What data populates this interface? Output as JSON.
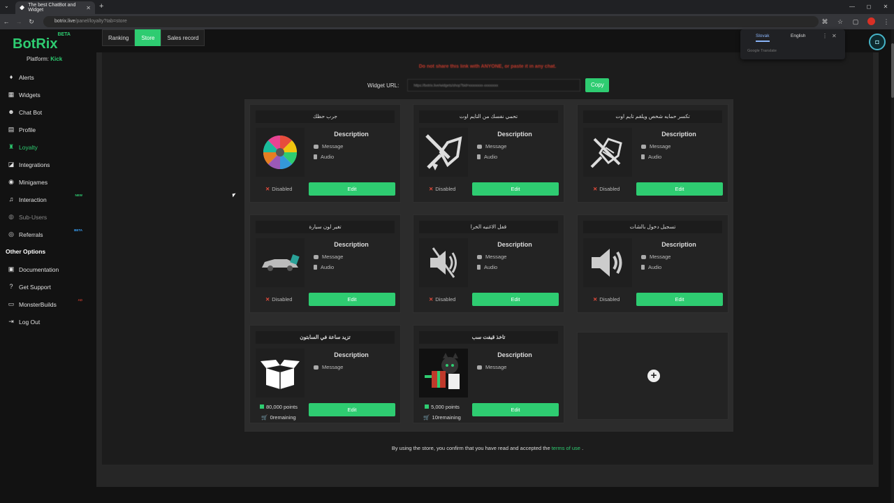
{
  "browser": {
    "tab_title": "The best ChatBot and Widget",
    "url_host": "botrix.live",
    "url_path": "/panel/loyalty?tab=store"
  },
  "translate_popup": {
    "option1": "Slovak",
    "option2": "English",
    "footer": "Google Translate"
  },
  "sidebar": {
    "logo": "BotRix",
    "logo_badge": "BETA",
    "platform_label": "Platform:",
    "platform_value": "Kick",
    "items": [
      {
        "label": "Alerts",
        "icon": "bell-icon"
      },
      {
        "label": "Widgets",
        "icon": "grid-icon"
      },
      {
        "label": "Chat Bot",
        "icon": "bot-icon"
      },
      {
        "label": "Profile",
        "icon": "profile-icon"
      },
      {
        "label": "Loyalty",
        "icon": "trophy-icon"
      },
      {
        "label": "Integrations",
        "icon": "integrations-icon"
      },
      {
        "label": "Minigames",
        "icon": "gamepad-icon"
      },
      {
        "label": "Interaction",
        "icon": "music-icon",
        "badge": "NEW"
      },
      {
        "label": "Sub-Users",
        "icon": "users-icon"
      },
      {
        "label": "Referrals",
        "icon": "referrals-icon",
        "badge": "BETA"
      }
    ],
    "section_title": "Other Options",
    "other_items": [
      {
        "label": "Documentation",
        "icon": "book-icon"
      },
      {
        "label": "Get Support",
        "icon": "question-icon"
      },
      {
        "label": "MonsterBuilds",
        "icon": "monitor-icon",
        "badge": "AD"
      },
      {
        "label": "Log Out",
        "icon": "logout-icon"
      }
    ]
  },
  "tabs": [
    "Ranking",
    "Store",
    "Sales record"
  ],
  "store": {
    "warning": "Do not share this link with ANYONE, or paste it in any chat.",
    "widget_url_label": "Widget URL:",
    "widget_url_value": "https://botrix.live/widgets/shop?bid=xxxxxxxx-xxxxxxxx",
    "copy_label": "Copy",
    "cards": [
      {
        "title": "جرب حظك",
        "desc": "Description",
        "message": "Message",
        "audio": "Audio",
        "status": "Disabled",
        "edit": "Edit",
        "img": "wheel"
      },
      {
        "title": "تحمي نفسك من التايم اوت",
        "desc": "Description",
        "message": "Message",
        "audio": "Audio",
        "status": "Disabled",
        "edit": "Edit",
        "img": "shield"
      },
      {
        "title": "تكسر حمايه شخص ويلقم تايم اوت",
        "desc": "Description",
        "message": "Message",
        "audio": "Audio",
        "status": "Disabled",
        "edit": "Edit",
        "img": "break"
      },
      {
        "title": "تغير لون سيارة",
        "desc": "Description",
        "message": "Message",
        "audio": "Audio",
        "status": "Disabled",
        "edit": "Edit",
        "img": "car"
      },
      {
        "title": "قفل الاغنيه الخرا",
        "desc": "Description",
        "message": "Message",
        "audio": "Audio",
        "status": "Disabled",
        "edit": "Edit",
        "img": "mute"
      },
      {
        "title": "تسجيل دخول بالشات",
        "desc": "Description",
        "message": "Message",
        "audio": "Audio",
        "status": "Disabled",
        "edit": "Edit",
        "img": "speaker"
      },
      {
        "title": "تزيد ساعة في السابتون",
        "desc": "Description",
        "message": "Message",
        "points": "80,000 points",
        "remaining": "0remaining",
        "edit": "Edit",
        "img": "box"
      },
      {
        "title": "تاخذ قيفت سب",
        "desc": "Description",
        "message": "Message",
        "points": "5,000 points",
        "remaining": "10remaining",
        "edit": "Edit",
        "img": "gift"
      }
    ],
    "footer_text": "By using the store, you confirm that you have read and accepted the",
    "footer_link": "terms of use",
    "footer_end": "."
  },
  "colors": {
    "accent": "#2ecc71",
    "warning": "#c0392b",
    "background": "#121212"
  }
}
